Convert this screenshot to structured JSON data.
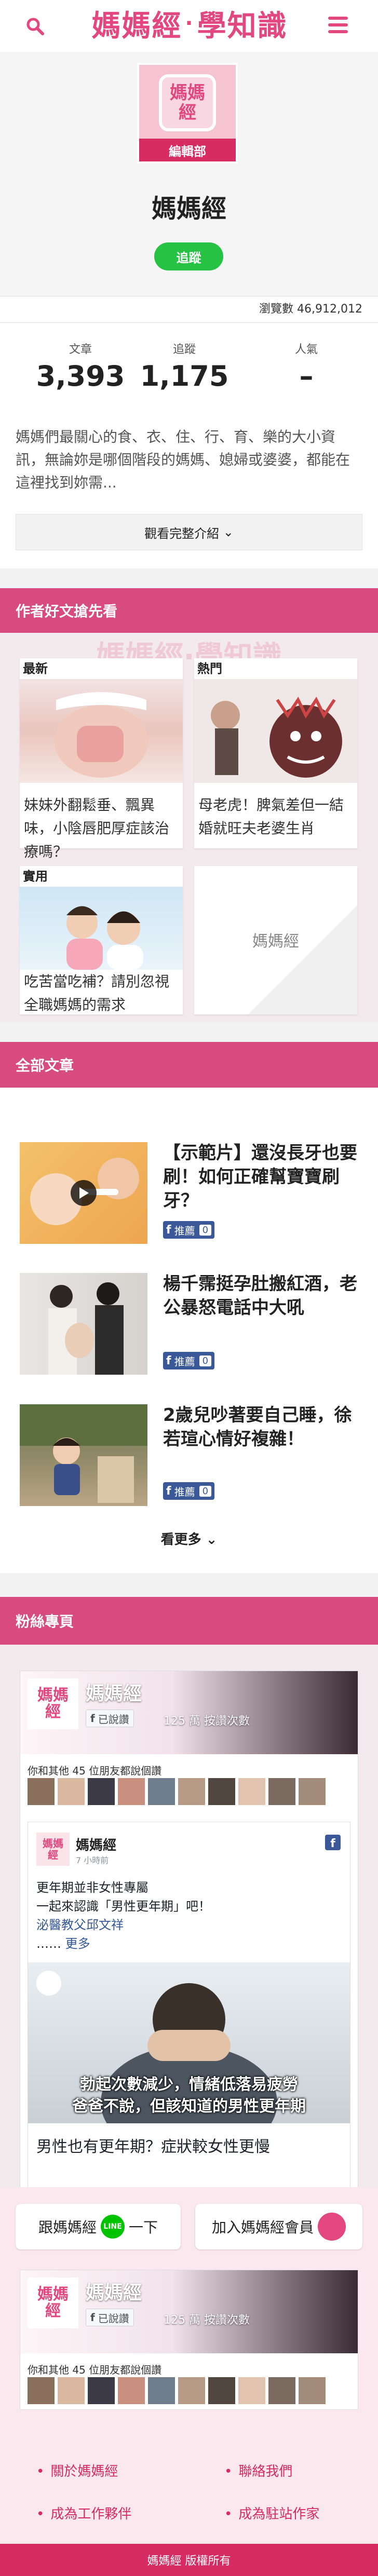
{
  "header": {
    "logo_main": "媽媽經",
    "logo_dot": "·",
    "logo_sub": "學知識"
  },
  "profile": {
    "avatar_text": "媽媽經",
    "editor_badge": "編輯部",
    "name": "媽媽經",
    "follow_label": "追蹤",
    "views_label": "瀏覽數",
    "views_value": "46,912,012",
    "stats": [
      {
        "label": "文章",
        "value": "3,393"
      },
      {
        "label": "追蹤",
        "value": "1,175"
      },
      {
        "label": "人氣",
        "value": "–"
      }
    ],
    "intro": "媽媽們最關心的食、衣、住、行、育、樂的大小資訊，無論妳是哪個階段的媽媽、媳婦或婆婆，都能在這裡找到妳需...",
    "full_intro_label": "觀看完整介紹"
  },
  "featured": {
    "title": "作者好文搶先看",
    "cards": [
      {
        "tag": "最新",
        "text": "妹妹外翻鬆垂、飄異味，小陰唇肥厚症該治療嗎？"
      },
      {
        "tag": "熱門",
        "text": "母老虎！脾氣差但一結婚就旺夫老婆生肖"
      },
      {
        "tag": "實用",
        "text": "吃苦當吃補？請別忽視全職媽媽的需求"
      },
      {
        "tag": "",
        "text": "媽媽經"
      }
    ]
  },
  "all_articles": {
    "title": "全部文章",
    "items": [
      {
        "title": "【示範片】還沒長牙也要刷！如何正確幫寶寶刷牙？",
        "fb_label": "推薦",
        "fb_count": "0"
      },
      {
        "title": "楊千霈挺孕肚搬紅酒，老公暴怒電話中大吼",
        "fb_label": "推薦",
        "fb_count": "0"
      },
      {
        "title": "2歲兒吵著要自己睡，徐若瑄心情好複雜！",
        "fb_label": "推薦",
        "fb_count": "0"
      }
    ],
    "more_label": "看更多"
  },
  "fans": {
    "title": "粉絲專頁",
    "page_name": "媽媽經",
    "liked_label": "已說讚",
    "fans_count": "125 萬 按讚次數",
    "friends_text": "你和其他 45 位朋友都說個讚",
    "post_name": "媽媽經",
    "post_time": "7 小時前",
    "post_text_1": "更年期並非女性專屬",
    "post_text_2": "一起來認識「男性更年期」吧！",
    "post_link": "泌醫教父邱文祥",
    "post_more_prefix": "……",
    "post_more": "更多",
    "image_caption_1": "勃起次數減少，情緒低落易疲勞",
    "image_caption_2": "爸爸不說，但該知道的男性更年期",
    "link_title": "男性也有更年期？症狀較女性更慢"
  },
  "bottom": {
    "line_prefix": "跟媽媽經",
    "line_badge": "LINE",
    "line_suffix": "一下",
    "member_label": "加入媽媽經會員"
  },
  "footer": {
    "links": [
      "關於媽媽經",
      "聯絡我們",
      "成為工作夥伴",
      "成為駐站作家"
    ],
    "copyright": "媽媽經 版權所有"
  },
  "colors": {
    "brand": "#e2487d",
    "section": "#d74c7c",
    "follow": "#25c244",
    "facebook": "#3b5998"
  }
}
